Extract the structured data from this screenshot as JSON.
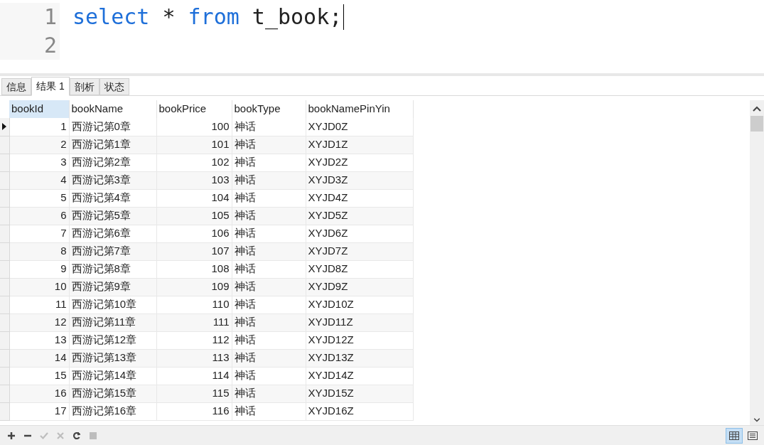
{
  "editor": {
    "lines": [
      {
        "number": "1",
        "tokens": [
          {
            "kind": "keyword",
            "text": "select"
          },
          {
            "kind": "plain",
            "text": " * "
          },
          {
            "kind": "keyword",
            "text": "from"
          },
          {
            "kind": "plain",
            "text": " t_book;"
          }
        ],
        "cursor": true
      },
      {
        "number": "2",
        "cursor": false
      }
    ]
  },
  "tabs": [
    {
      "label": "信息",
      "selected": false
    },
    {
      "label": "结果 1",
      "selected": true
    },
    {
      "label": "剖析",
      "selected": false
    },
    {
      "label": "状态",
      "selected": false
    }
  ],
  "table": {
    "columns": [
      {
        "label": "bookId",
        "selected": true
      },
      {
        "label": "bookName",
        "selected": false
      },
      {
        "label": "bookPrice",
        "selected": false
      },
      {
        "label": "bookType",
        "selected": false
      },
      {
        "label": "bookNamePinYin",
        "selected": false
      }
    ],
    "rows": [
      {
        "current": true,
        "cells": [
          "1",
          "西游记第0章",
          "100",
          "神话",
          "XYJD0Z"
        ]
      },
      {
        "current": false,
        "cells": [
          "2",
          "西游记第1章",
          "101",
          "神话",
          "XYJD1Z"
        ]
      },
      {
        "current": false,
        "cells": [
          "3",
          "西游记第2章",
          "102",
          "神话",
          "XYJD2Z"
        ]
      },
      {
        "current": false,
        "cells": [
          "4",
          "西游记第3章",
          "103",
          "神话",
          "XYJD3Z"
        ]
      },
      {
        "current": false,
        "cells": [
          "5",
          "西游记第4章",
          "104",
          "神话",
          "XYJD4Z"
        ]
      },
      {
        "current": false,
        "cells": [
          "6",
          "西游记第5章",
          "105",
          "神话",
          "XYJD5Z"
        ]
      },
      {
        "current": false,
        "cells": [
          "7",
          "西游记第6章",
          "106",
          "神话",
          "XYJD6Z"
        ]
      },
      {
        "current": false,
        "cells": [
          "8",
          "西游记第7章",
          "107",
          "神话",
          "XYJD7Z"
        ]
      },
      {
        "current": false,
        "cells": [
          "9",
          "西游记第8章",
          "108",
          "神话",
          "XYJD8Z"
        ]
      },
      {
        "current": false,
        "cells": [
          "10",
          "西游记第9章",
          "109",
          "神话",
          "XYJD9Z"
        ]
      },
      {
        "current": false,
        "cells": [
          "11",
          "西游记第10章",
          "110",
          "神话",
          "XYJD10Z"
        ]
      },
      {
        "current": false,
        "cells": [
          "12",
          "西游记第11章",
          "111",
          "神话",
          "XYJD11Z"
        ]
      },
      {
        "current": false,
        "cells": [
          "13",
          "西游记第12章",
          "112",
          "神话",
          "XYJD12Z"
        ]
      },
      {
        "current": false,
        "cells": [
          "14",
          "西游记第13章",
          "113",
          "神话",
          "XYJD13Z"
        ]
      },
      {
        "current": false,
        "cells": [
          "15",
          "西游记第14章",
          "114",
          "神话",
          "XYJD14Z"
        ]
      },
      {
        "current": false,
        "cells": [
          "16",
          "西游记第15章",
          "115",
          "神话",
          "XYJD15Z"
        ]
      },
      {
        "current": false,
        "cells": [
          "17",
          "西游记第16章",
          "116",
          "神话",
          "XYJD16Z"
        ]
      }
    ]
  },
  "toolbar": {
    "actions": [
      {
        "kind": "add",
        "disabled": false
      },
      {
        "kind": "delete",
        "disabled": false
      },
      {
        "kind": "apply",
        "disabled": true
      },
      {
        "kind": "discard",
        "disabled": true
      },
      {
        "kind": "refresh",
        "disabled": false
      },
      {
        "kind": "stop",
        "disabled": true
      }
    ],
    "views": [
      {
        "kind": "grid",
        "selected": true
      },
      {
        "kind": "form",
        "selected": false
      }
    ]
  }
}
